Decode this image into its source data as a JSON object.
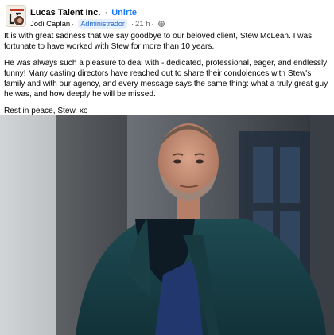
{
  "post": {
    "group_name": "Lucas Talent Inc.",
    "separator": "·",
    "join_label": "Unirte",
    "author": "Jodi Caplan",
    "role_badge": "Administrador",
    "time": "21 h",
    "privacy_icon": "globe-icon",
    "paragraphs": [
      "It is with great sadness that we say goodbye to our beloved client, Stew McLean. I was fortunate to have worked with Stew for more than 10 years.",
      "He was always such a pleasure to deal with - dedicated, professional, eager, and endlessly funny! Many casting directors have reached out to share their condolences with Stew's family and with our agency, and every message says the same thing: what a truly great guy he was, and how deeply he will be missed.",
      "Rest in peace, Stew. xo"
    ]
  },
  "colors": {
    "link_blue": "#1877f2",
    "secondary_text": "#65676b",
    "badge_bg": "#e7f0fd"
  }
}
